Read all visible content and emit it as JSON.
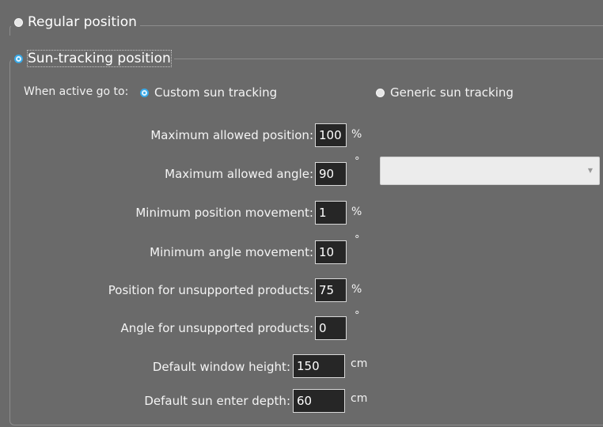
{
  "regular_group": {
    "label": "Regular position",
    "selected": false
  },
  "sun_group": {
    "label": "Sun-tracking position",
    "selected": true,
    "when_active_label": "When active go to:",
    "options": [
      {
        "label": "Custom sun tracking",
        "selected": true
      },
      {
        "label": "Generic sun tracking",
        "selected": false
      }
    ],
    "generic_dropdown": {
      "value": "",
      "arrow": "▼"
    },
    "fields": [
      {
        "label": "Maximum allowed position:",
        "value": "100",
        "unit": "%"
      },
      {
        "label": "Maximum allowed angle:",
        "value": "90",
        "unit": "°"
      },
      {
        "label": "Minimum position movement:",
        "value": "1",
        "unit": "%"
      },
      {
        "label": "Minimum angle movement:",
        "value": "10",
        "unit": "°"
      },
      {
        "label": "Position for unsupported products:",
        "value": "75",
        "unit": "%"
      },
      {
        "label": "Angle for unsupported products:",
        "value": "0",
        "unit": "°"
      },
      {
        "label": "Default window height:",
        "value": "150",
        "unit": "cm"
      },
      {
        "label": "Default sun enter depth:",
        "value": "60",
        "unit": "cm"
      }
    ]
  },
  "colors": {
    "background": "#6a6a6a",
    "field_background": "#262626",
    "radio_accent": "#37a9e8"
  }
}
